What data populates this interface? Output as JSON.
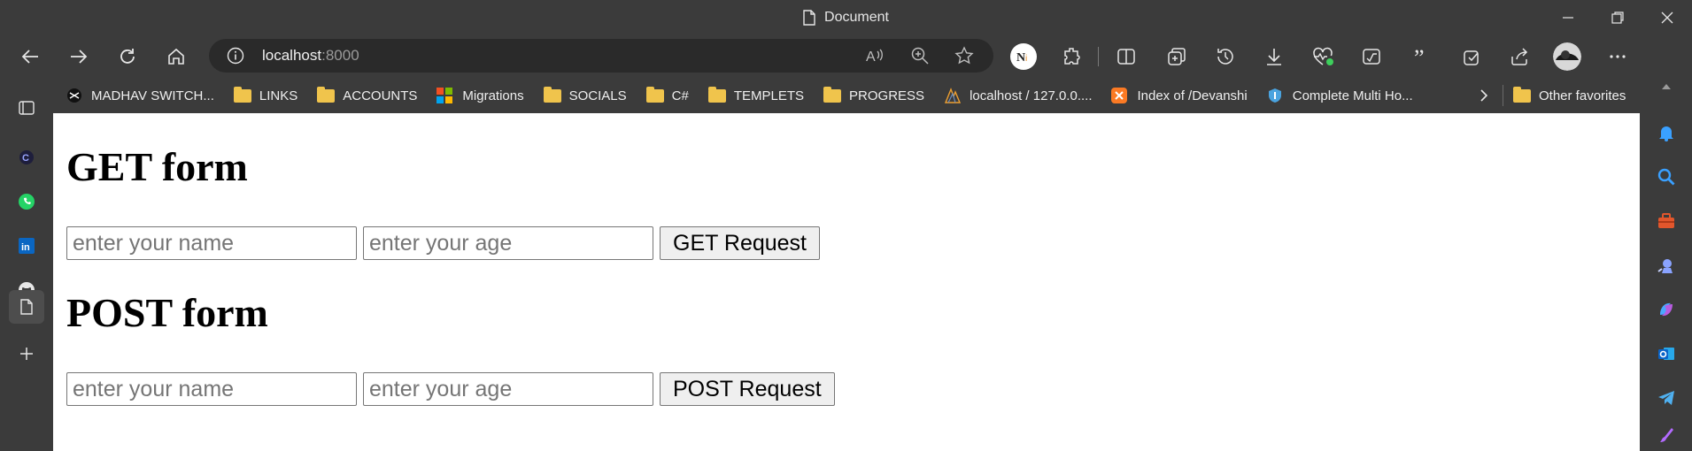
{
  "window": {
    "title": "Document",
    "title_icon": "document-icon",
    "controls": [
      "minimize-icon",
      "restore-icon",
      "close-icon"
    ]
  },
  "toolbar": {
    "nav_icons": [
      "back-icon",
      "forward-icon",
      "refresh-icon",
      "home-icon"
    ],
    "address": {
      "host": "localhost",
      "port": ":8000"
    },
    "right_icons": [
      "read-aloud-icon",
      "zoom-icon",
      "favorite-star-icon",
      "extension-n-icon",
      "extensions-icon",
      "split-screen-icon",
      "collections-icon",
      "history-icon",
      "downloads-icon",
      "performance-icon",
      "math-solver-icon",
      "quote-icon",
      "screenshot-icon",
      "share-icon",
      "profile-avatar",
      "more-icon",
      "bing-copilot-icon"
    ]
  },
  "favorites": {
    "items": [
      {
        "label": "MADHAV SWITCH...",
        "icon": "switch-icon"
      },
      {
        "label": "LINKS",
        "icon": "folder-icon"
      },
      {
        "label": "ACCOUNTS",
        "icon": "folder-icon"
      },
      {
        "label": "Migrations",
        "icon": "microsoft-icon"
      },
      {
        "label": "SOCIALS",
        "icon": "folder-icon"
      },
      {
        "label": "C#",
        "icon": "folder-icon"
      },
      {
        "label": "TEMPLETS",
        "icon": "folder-icon"
      },
      {
        "label": "PROGRESS",
        "icon": "folder-icon"
      },
      {
        "label": "localhost / 127.0.0....",
        "icon": "phpmyadmin-icon"
      },
      {
        "label": "Index of /Devanshi",
        "icon": "xampp-icon"
      },
      {
        "label": "Complete Multi Ho...",
        "icon": "shield-icon"
      }
    ],
    "other": "Other favorites"
  },
  "page": {
    "get_heading": "GET form",
    "get_name_placeholder": "enter your name",
    "get_age_placeholder": "enter your age",
    "get_button": "GET Request",
    "post_heading": "POST form",
    "post_name_placeholder": "enter your name",
    "post_age_placeholder": "enter your age",
    "post_button": "POST Request"
  },
  "left_sidebar": [
    "tab-actions-icon",
    "app-c-icon",
    "whatsapp-icon",
    "linkedin-icon",
    "github-icon",
    "document-tab-icon",
    "add-icon"
  ],
  "right_sidebar": [
    "scroll-up-icon",
    "notifications-icon",
    "search-icon",
    "tools-icon",
    "games-icon",
    "copilot-icon",
    "outlook-icon",
    "telegram-icon",
    "designer-icon"
  ],
  "colors": {
    "chrome": "#3b3b3b",
    "omnibox": "#2a2a2a",
    "page": "#ffffff",
    "folder": "#f0c44c"
  }
}
